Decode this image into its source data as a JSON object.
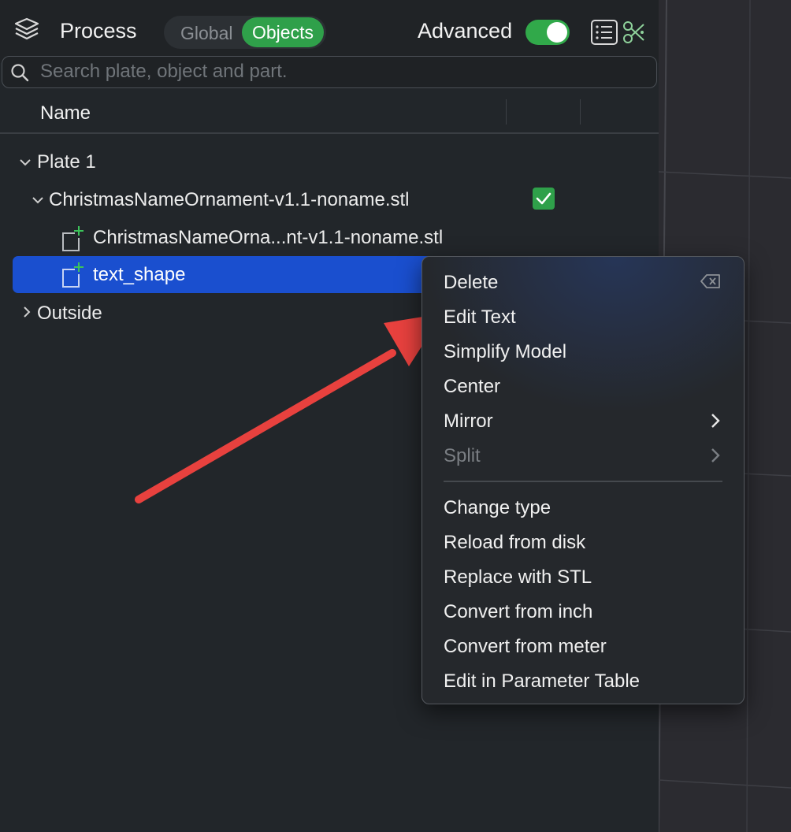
{
  "header": {
    "title": "Process",
    "tabs": {
      "global": "Global",
      "objects": "Objects",
      "active": "Objects"
    },
    "advanced_label": "Advanced",
    "advanced_on": true,
    "icons": [
      "layers-icon",
      "list-icon",
      "tools-icon"
    ]
  },
  "search": {
    "placeholder": "Search plate, object and part.",
    "value": ""
  },
  "columns": {
    "name": "Name"
  },
  "tree": {
    "plate": "Plate 1",
    "object": "ChristmasNameOrnament-v1.1-noname.stl",
    "object_checked": true,
    "parts": [
      "ChristmasNameOrna...nt-v1.1-noname.stl",
      "text_shape"
    ],
    "selected_part": "text_shape",
    "outside": "Outside"
  },
  "context_menu": {
    "group1": [
      "Delete",
      "Edit Text",
      "Simplify Model",
      "Center",
      "Mirror",
      "Split"
    ],
    "group2": [
      "Change type",
      "Reload from disk",
      "Replace with STL",
      "Convert from inch",
      "Convert from meter",
      "Edit in Parameter Table"
    ],
    "disabled": [
      "Split"
    ],
    "submenus": [
      "Mirror",
      "Split"
    ],
    "delete_shortcut_icon": "delete-key-icon"
  },
  "annotation": {
    "type": "arrow",
    "color": "#e8413e",
    "points_to": "Edit Text"
  },
  "colors": {
    "accent": "#2fa04a",
    "selection": "#1a4fcf",
    "panel": "#22262a",
    "viewport": "#2b2b30"
  }
}
